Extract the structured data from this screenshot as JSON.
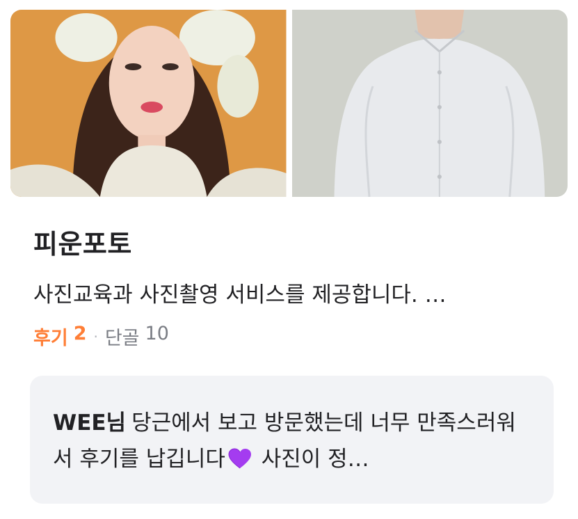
{
  "store": {
    "name": "피운포토",
    "description": "사진교육과 사진촬영 서비스를 제공합니다. …",
    "stats": {
      "review_label": "후기",
      "review_count": "2",
      "separator": "·",
      "regular_label": "단골",
      "regular_count": "10"
    },
    "photos": [
      {
        "icon": "portrait-woman-flower-crown-photo"
      },
      {
        "icon": "portrait-man-white-shirt-photo"
      }
    ]
  },
  "review": {
    "reviewer": "WEE님",
    "text_part1": "당근에서 보고 방문했는데 너무 만족스러워서 후기를 납깁니다",
    "emoji": "purple-heart-icon",
    "text_part2": " 사진이 정…"
  },
  "colors": {
    "accent": "#ff7e36",
    "review_bg": "#f2f3f6",
    "muted_text": "#7a7d84"
  }
}
